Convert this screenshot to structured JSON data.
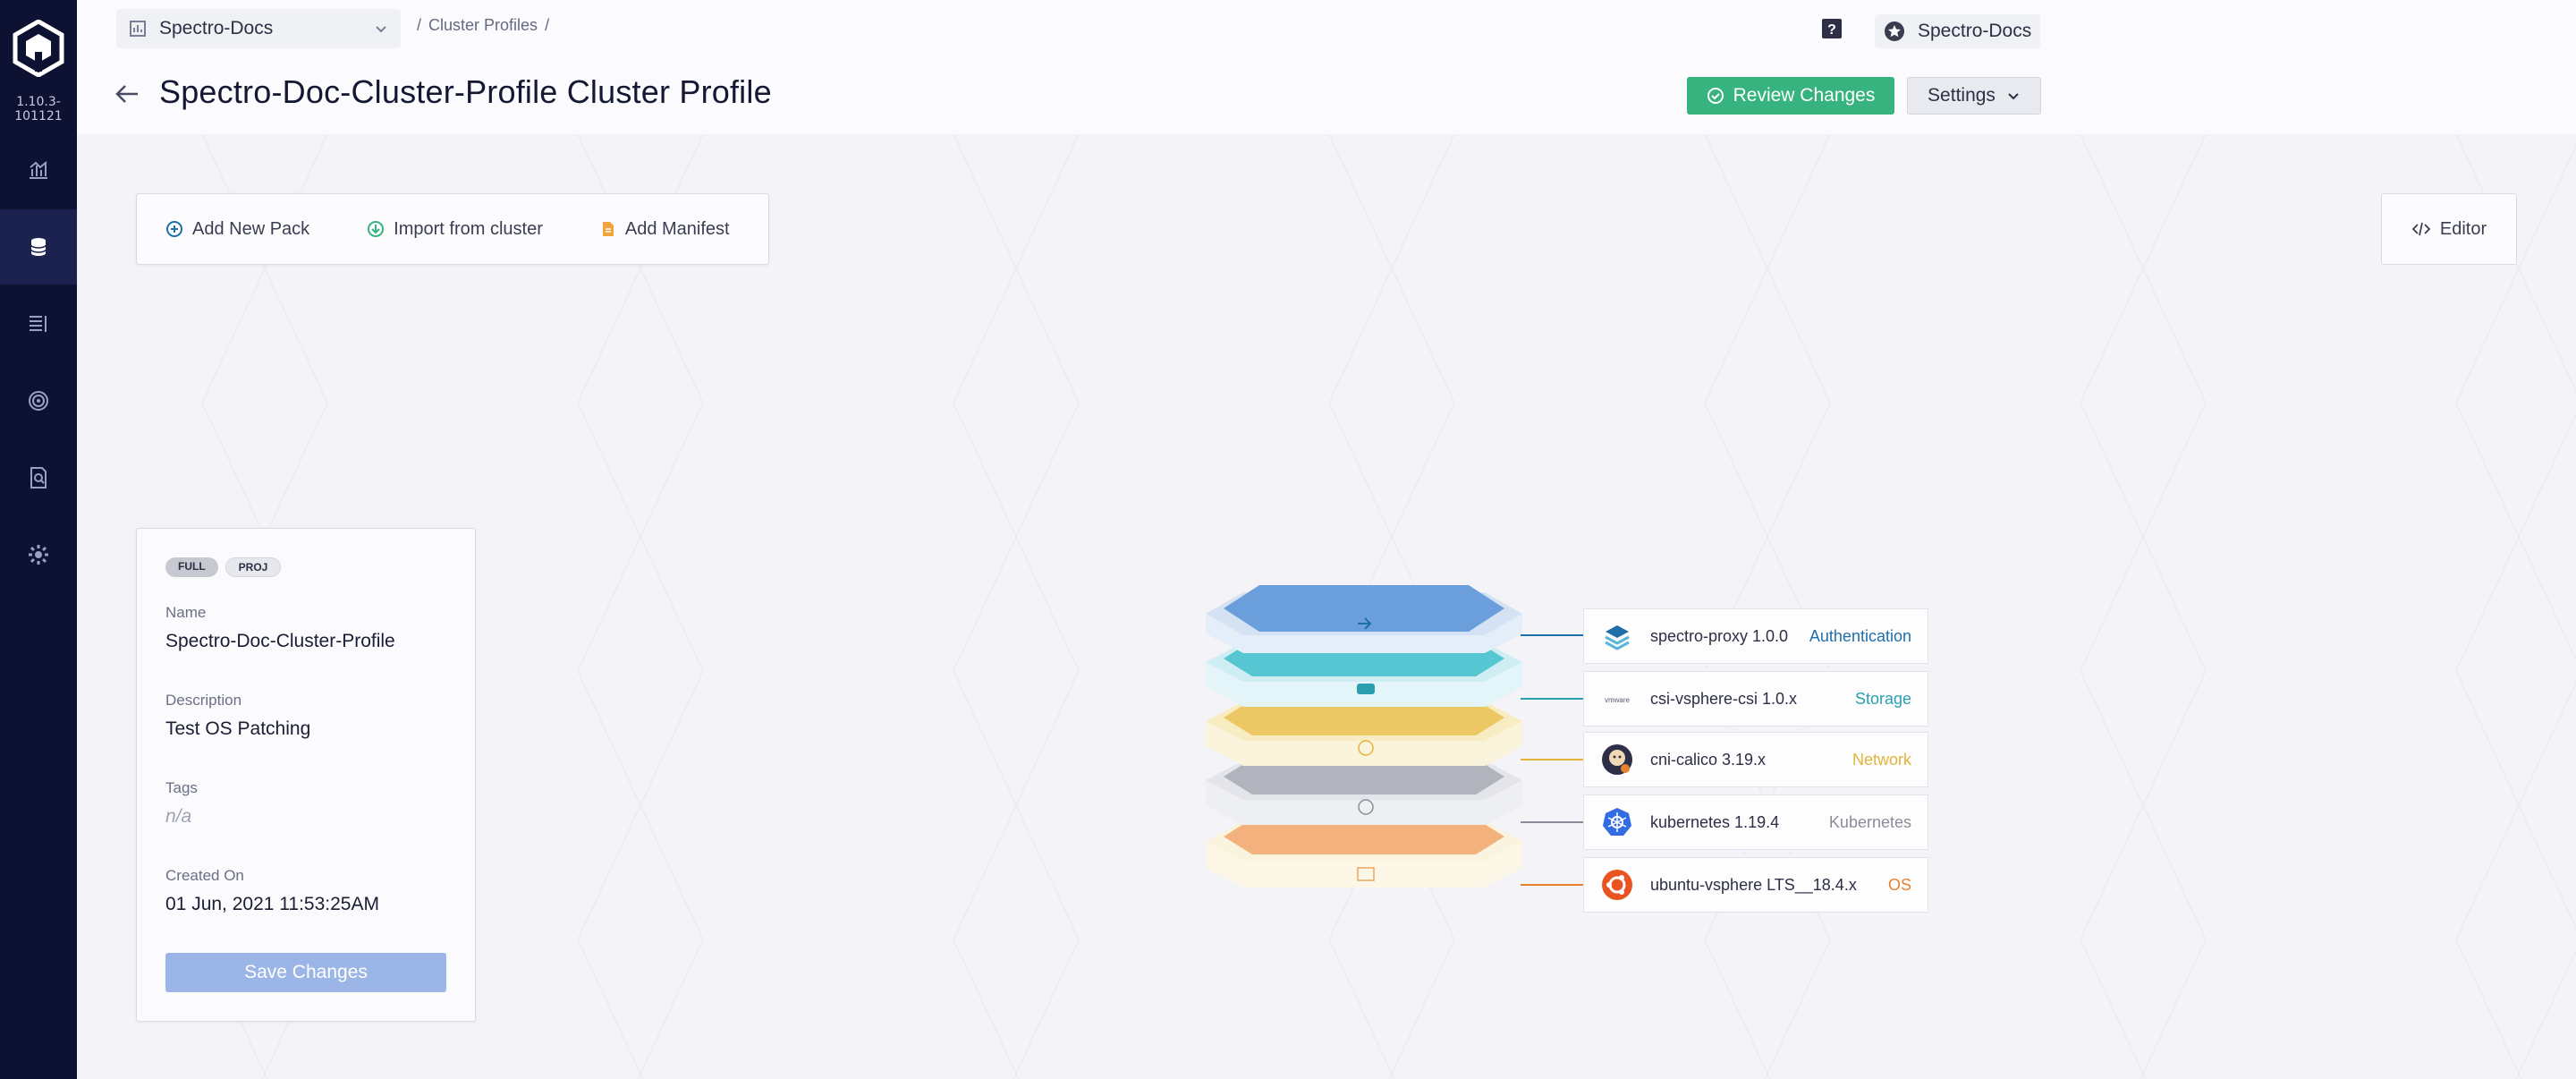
{
  "app": {
    "version": "1.10.3-101121"
  },
  "sidebar": {
    "items": [
      {
        "icon": "chart-icon",
        "active": false
      },
      {
        "icon": "database-icon",
        "active": true
      },
      {
        "icon": "list-icon",
        "active": false
      },
      {
        "icon": "fingerprint-icon",
        "active": false
      },
      {
        "icon": "document-search-icon",
        "active": false
      },
      {
        "icon": "gear-icon",
        "active": false
      }
    ]
  },
  "header": {
    "project": "Spectro-Docs",
    "breadcrumb": {
      "separator": "/",
      "section": "Cluster Profiles"
    },
    "user_name": "Spectro-Docs",
    "title": "Spectro-Doc-Cluster-Profile Cluster Profile",
    "review_label": "Review Changes",
    "settings_label": "Settings"
  },
  "toolbar": {
    "add_pack": "Add New Pack",
    "import_cluster": "Import from cluster",
    "add_manifest": "Add Manifest",
    "editor": "Editor"
  },
  "profile": {
    "tags": [
      "FULL",
      "PROJ"
    ],
    "name_label": "Name",
    "name": "Spectro-Doc-Cluster-Profile",
    "description_label": "Description",
    "description": "Test OS Patching",
    "tags_label": "Tags",
    "tags_value": "n/a",
    "created_label": "Created On",
    "created": "01 Jun, 2021 11:53:25AM",
    "save_label": "Save Changes"
  },
  "layers": [
    {
      "name": "spectro-proxy 1.0.0",
      "type": "Authentication",
      "color": "#1f6fa8",
      "icon": "spectro-proxy-icon"
    },
    {
      "name": "csi-vsphere-csi 1.0.x",
      "type": "Storage",
      "color": "#2a9fb0",
      "icon": "vmware-icon"
    },
    {
      "name": "cni-calico 3.19.x",
      "type": "Network",
      "color": "#e3b33c",
      "icon": "calico-icon"
    },
    {
      "name": "kubernetes 1.19.4",
      "type": "Kubernetes",
      "color": "#8a8c99",
      "icon": "kubernetes-icon"
    },
    {
      "name": "ubuntu-vsphere LTS__18.4.x",
      "type": "OS",
      "color": "#e8812e",
      "icon": "ubuntu-icon"
    }
  ],
  "colors": {
    "accent_green": "#36b37e",
    "sidebar_bg": "#0d1233",
    "save_button": "#9bb5e6"
  }
}
